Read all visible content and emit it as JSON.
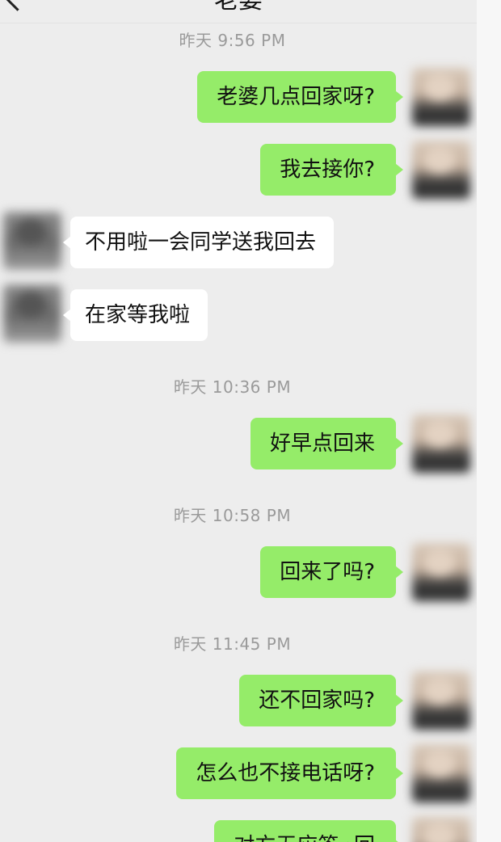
{
  "header": {
    "title": "老婆",
    "back_icon": "chevron-left-icon"
  },
  "colors": {
    "screen_background": "#ededed",
    "my_bubble": "#95ec69",
    "their_bubble": "#ffffff",
    "timestamp_text": "#9a9a9a"
  },
  "messages": [
    {
      "kind": "timestamp",
      "text": "昨天 9:56 PM"
    },
    {
      "kind": "sent",
      "text": "老婆几点回家呀?"
    },
    {
      "kind": "sent",
      "text": "我去接你?"
    },
    {
      "kind": "received",
      "text": "不用啦一会同学送我回去"
    },
    {
      "kind": "received",
      "text": "在家等我啦"
    },
    {
      "kind": "timestamp",
      "text": "昨天 10:36 PM"
    },
    {
      "kind": "sent",
      "text": "好早点回来"
    },
    {
      "kind": "timestamp",
      "text": "昨天 10:58 PM"
    },
    {
      "kind": "sent",
      "text": "回来了吗?"
    },
    {
      "kind": "timestamp",
      "text": "昨天 11:45 PM"
    },
    {
      "kind": "sent",
      "text": "还不回家吗?"
    },
    {
      "kind": "sent",
      "text": "怎么也不接电话呀?"
    },
    {
      "kind": "sent",
      "text": "对方无应答 ›回"
    }
  ]
}
